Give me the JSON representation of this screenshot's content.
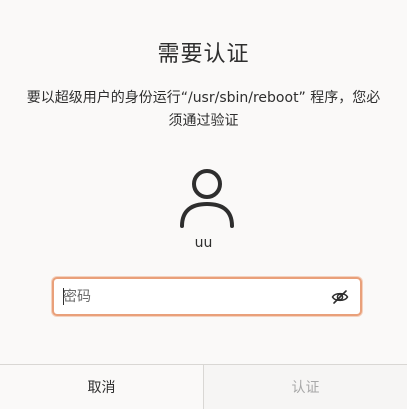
{
  "dialog": {
    "title": "需要认证",
    "message": "要以超级用户的身份运行“/usr/sbin/reboot” 程序，您必须通过验证",
    "user": {
      "avatar_icon": "user-avatar-icon",
      "name": "uu"
    },
    "password": {
      "placeholder": "密码",
      "value": "",
      "visibility_icon": "eye-hidden-icon"
    },
    "buttons": {
      "cancel_label": "取消",
      "authenticate_label": "认证"
    }
  },
  "colors": {
    "focus_border": "#e9a07a",
    "text": "#2e2e2e",
    "disabled_text": "#a8a8a8"
  }
}
